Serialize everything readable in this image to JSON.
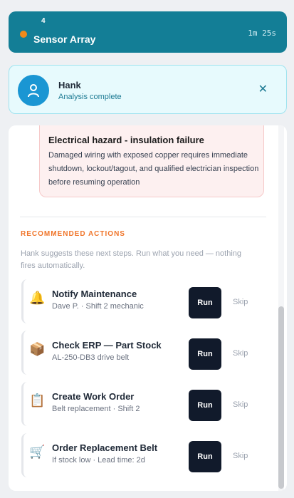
{
  "header": {
    "count": "4",
    "title": "Sensor Array",
    "timer": "1m 25s"
  },
  "agent": {
    "name": "Hank",
    "status": "Analysis complete",
    "close": "✕"
  },
  "hazard": {
    "title": "Electrical hazard - insulation failure",
    "body": "Damaged wiring with exposed copper requires immediate shutdown, lockout/tagout, and qualified electrician inspection before resuming operation"
  },
  "actions_section": {
    "title": "RECOMMENDED ACTIONS",
    "hint": "Hank suggests these next steps. Run what you need — nothing fires automatically.",
    "items": [
      {
        "icon": "🔔",
        "icon_name": "bell-icon",
        "title": "Notify Maintenance",
        "subtitle": "Dave P. · Shift 2 mechanic",
        "run": "Run",
        "skip": "Skip"
      },
      {
        "icon": "📦",
        "icon_name": "package-icon",
        "title": "Check ERP — Part Stock",
        "subtitle": "AL-250-DB3 drive belt",
        "run": "Run",
        "skip": "Skip"
      },
      {
        "icon": "📋",
        "icon_name": "clipboard-icon",
        "title": "Create Work Order",
        "subtitle": "Belt replacement · Shift 2",
        "run": "Run",
        "skip": "Skip"
      },
      {
        "icon": "🛒",
        "icon_name": "cart-icon",
        "title": "Order Replacement Belt",
        "subtitle": "If stock low · Lead time: 2d",
        "run": "Run",
        "skip": "Skip"
      }
    ]
  },
  "colors": {
    "header_bg": "#137e96",
    "status_dot": "#f08a1a",
    "section_accent": "#f0752a",
    "run_button": "#111a2b",
    "hazard_bg": "#fdf0f0"
  }
}
